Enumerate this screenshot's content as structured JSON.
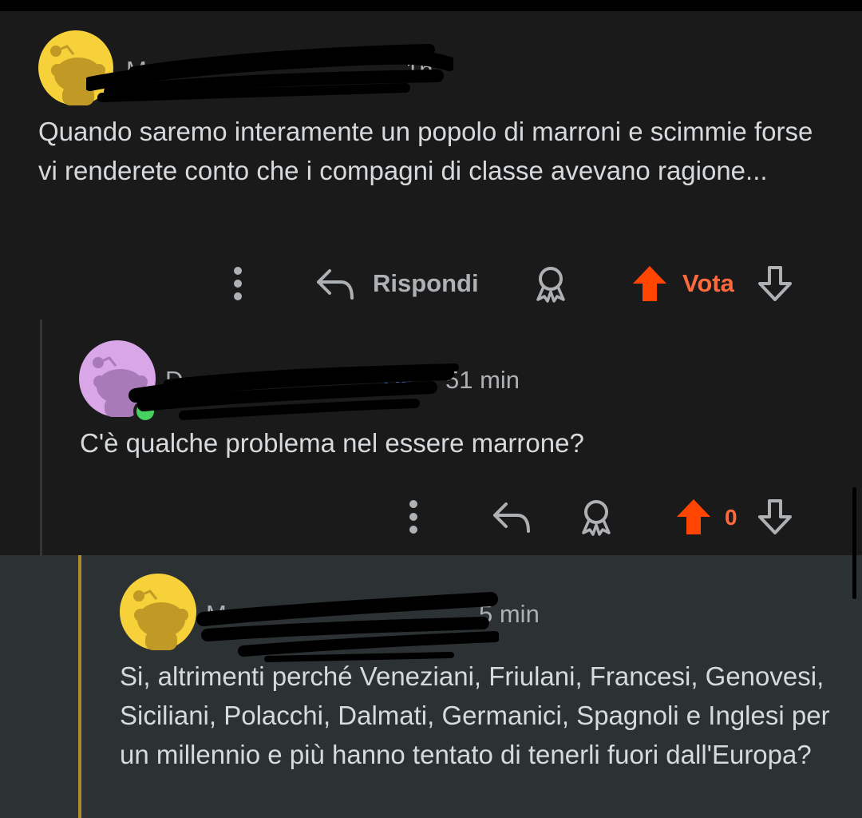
{
  "comments": [
    {
      "author_visible": "M",
      "time_visible": "1h",
      "avatar_color": "#f7d13a",
      "body": "Quando saremo interamente un popolo di marroni e scimmie forse vi renderete conto che i compagni di classe avevano ragione...",
      "actions": {
        "reply_label": "Rispondi",
        "vote_label": "Vota"
      }
    },
    {
      "author_visible": "D",
      "op_badge": "OP",
      "time_visible": "51 min",
      "avatar_color": "#d9a6e8",
      "online": true,
      "body": "C'è qualche problema nel essere marrone?",
      "actions": {
        "vote_count": "0"
      }
    },
    {
      "author_visible": "M",
      "time_visible": "5 min",
      "avatar_color": "#f7d13a",
      "highlighted": true,
      "body": "Si, altrimenti perché Veneziani, Friulani, Francesi, Genovesi, Siciliani, Polacchi, Dalmati, Germanici, Spagnoli e Inglesi per un millennio e più hanno tentato di tenerli fuori dall'Europa?"
    }
  ],
  "colors": {
    "background": "#1a1a1b",
    "highlight_background": "#2c3133",
    "upvote_accent": "#ff4500",
    "vote_text": "#ff6a3d",
    "thread_line_gold": "#b08a2e",
    "online_indicator": "#46d160"
  },
  "icons": [
    "more-options-icon",
    "reply-arrow-icon",
    "award-icon",
    "upvote-arrow-icon",
    "downvote-arrow-icon",
    "snoo-avatar-icon"
  ]
}
